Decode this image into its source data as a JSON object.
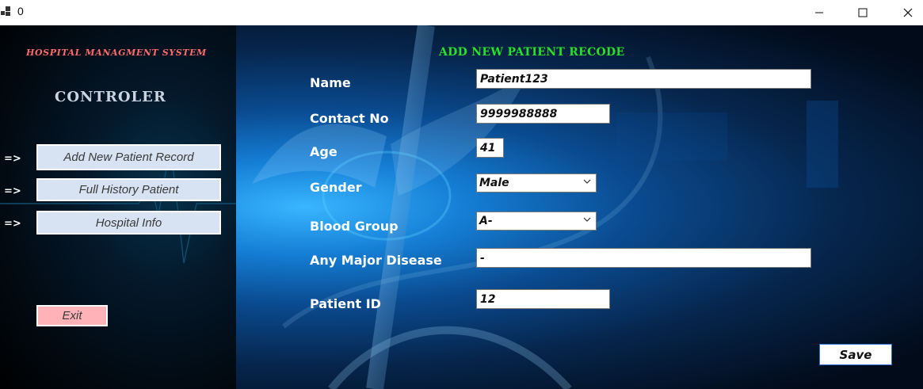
{
  "window": {
    "title": "0",
    "controls": {
      "minimize": "—",
      "maximize": "☐",
      "close": "✕"
    }
  },
  "sidebar": {
    "app_title": "Hospital Managment System",
    "heading": "CONTROLER",
    "arrow": "=>",
    "nav": [
      {
        "label": "Add New Patient Record"
      },
      {
        "label": "Full History Patient"
      },
      {
        "label": "Hospital Info"
      }
    ],
    "exit_label": "Exit"
  },
  "form": {
    "title": "ADD NEW PATIENT RECODE",
    "fields": {
      "name": {
        "label": "Name",
        "value": "Patient123"
      },
      "contact": {
        "label": "Contact No",
        "value": "9999988888"
      },
      "age": {
        "label": "Age",
        "value": "41"
      },
      "gender": {
        "label": "Gender",
        "value": "Male"
      },
      "blood_group": {
        "label": "Blood Group",
        "value": "A-"
      },
      "disease": {
        "label": "Any Major Disease",
        "value": "-"
      },
      "patient_id": {
        "label": "Patient ID",
        "value": "12"
      }
    },
    "save_label": "Save"
  },
  "colors": {
    "app_title": "#ff6b6b",
    "form_title": "#27e027",
    "nav_button_bg": "#d7e3f2",
    "exit_button_bg": "#ffb3b8"
  }
}
